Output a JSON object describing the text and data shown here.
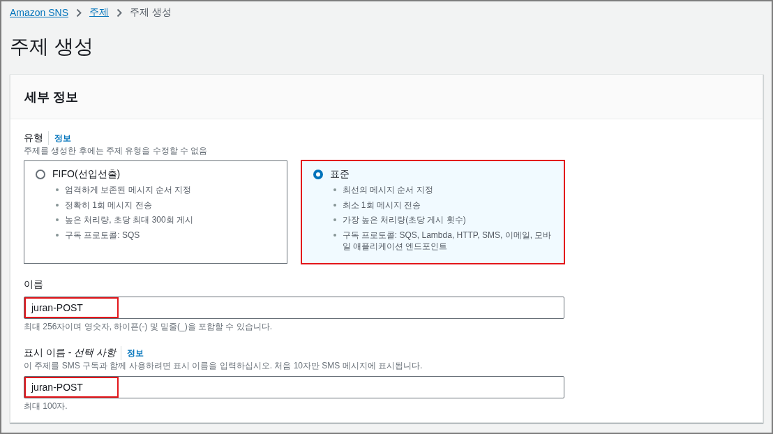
{
  "breadcrumb": [
    {
      "label": "Amazon SNS",
      "kind": "link"
    },
    {
      "label": "주제",
      "kind": "link"
    },
    {
      "label": "주제 생성",
      "kind": "current"
    }
  ],
  "page_title": "주제 생성",
  "details_panel": {
    "title": "세부 정보",
    "type": {
      "label": "유형",
      "info": "정보",
      "description": "주제를 생성한 후에는 주제 유형을 수정할 수 없음",
      "options": [
        {
          "title": "FIFO(선입선출)",
          "selected": false,
          "highlighted": false,
          "features": [
            "엄격하게 보존된 메시지 순서 지정",
            "정확히 1회 메시지 전송",
            "높은 처리량, 초당 최대 300회 게시",
            "구독 프로토콜: SQS"
          ]
        },
        {
          "title": "표준",
          "selected": true,
          "highlighted": true,
          "features": [
            "최선의 메시지 순서 지정",
            "최소 1회 메시지 전송",
            "가장 높은 처리량(초당 게시 횟수)",
            "구독 프로토콜: SQS, Lambda, HTTP, SMS, 이메일, 모바일 애플리케이션 엔드포인트"
          ]
        }
      ]
    },
    "fields": [
      {
        "label": "이름",
        "value": "juran-POST",
        "highlighted": true,
        "hint": "최대 256자이며 영숫자, 하이픈(-) 및 밑줄(_)을 포함할 수 있습니다."
      },
      {
        "label": "표시 이름 - *선택 사항*",
        "info": "정보",
        "description": "이 주제를 SMS 구독과 함께 사용하려면 표시 이름을 입력하십시오. 처음 10자만 SMS 메시지에 표시됩니다.",
        "value": "juran-POST",
        "highlighted": true,
        "hint": "최대 100자."
      }
    ]
  }
}
